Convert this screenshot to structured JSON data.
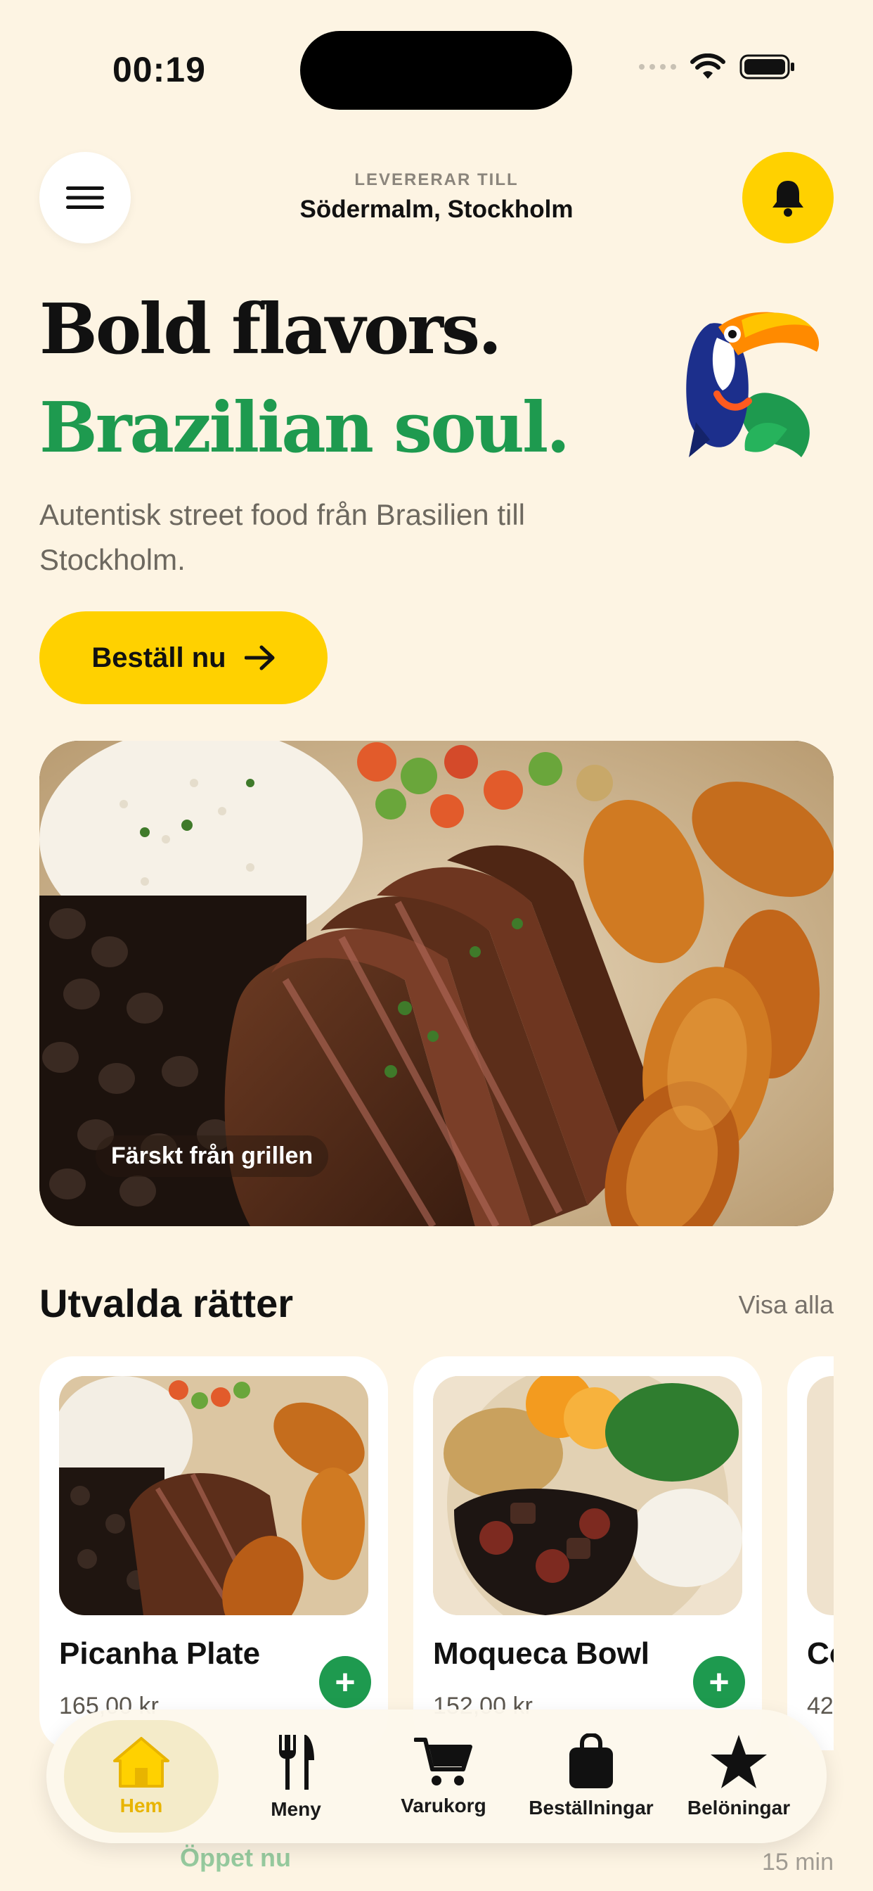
{
  "status_bar": {
    "time": "00:19"
  },
  "header": {
    "deliver_label": "LEVERERAR TILL",
    "deliver_location": "Södermalm, Stockholm",
    "menu_icon": "hamburger-icon",
    "bell_icon": "bell-icon"
  },
  "hero": {
    "title_line1": "Bold flavors.",
    "title_line2": "Brazilian soul.",
    "subtitle": "Autentisk street food från Brasilien till Stockholm.",
    "cta_label": "Beställ nu",
    "image_caption": "Färskt från grillen"
  },
  "featured": {
    "title": "Utvalda rätter",
    "see_all": "Visa alla",
    "dishes": [
      {
        "name": "Picanha Plate",
        "price": "165,00 kr"
      },
      {
        "name": "Moqueca Bowl",
        "price": "152,00 kr"
      },
      {
        "name": "Co",
        "price": "42"
      }
    ]
  },
  "behind_nav": {
    "open_label": "Öppet nu",
    "eta": "15 min"
  },
  "nav": {
    "items": [
      {
        "label": "Hem",
        "icon": "home-icon"
      },
      {
        "label": "Meny",
        "icon": "cutlery-icon"
      },
      {
        "label": "Varukorg",
        "icon": "cart-icon"
      },
      {
        "label": "Beställningar",
        "icon": "bag-icon"
      },
      {
        "label": "Belöningar",
        "icon": "star-icon"
      }
    ]
  },
  "colors": {
    "background": "#FDF4E3",
    "accent_yellow": "#FFD100",
    "accent_green": "#1E9A4F"
  }
}
